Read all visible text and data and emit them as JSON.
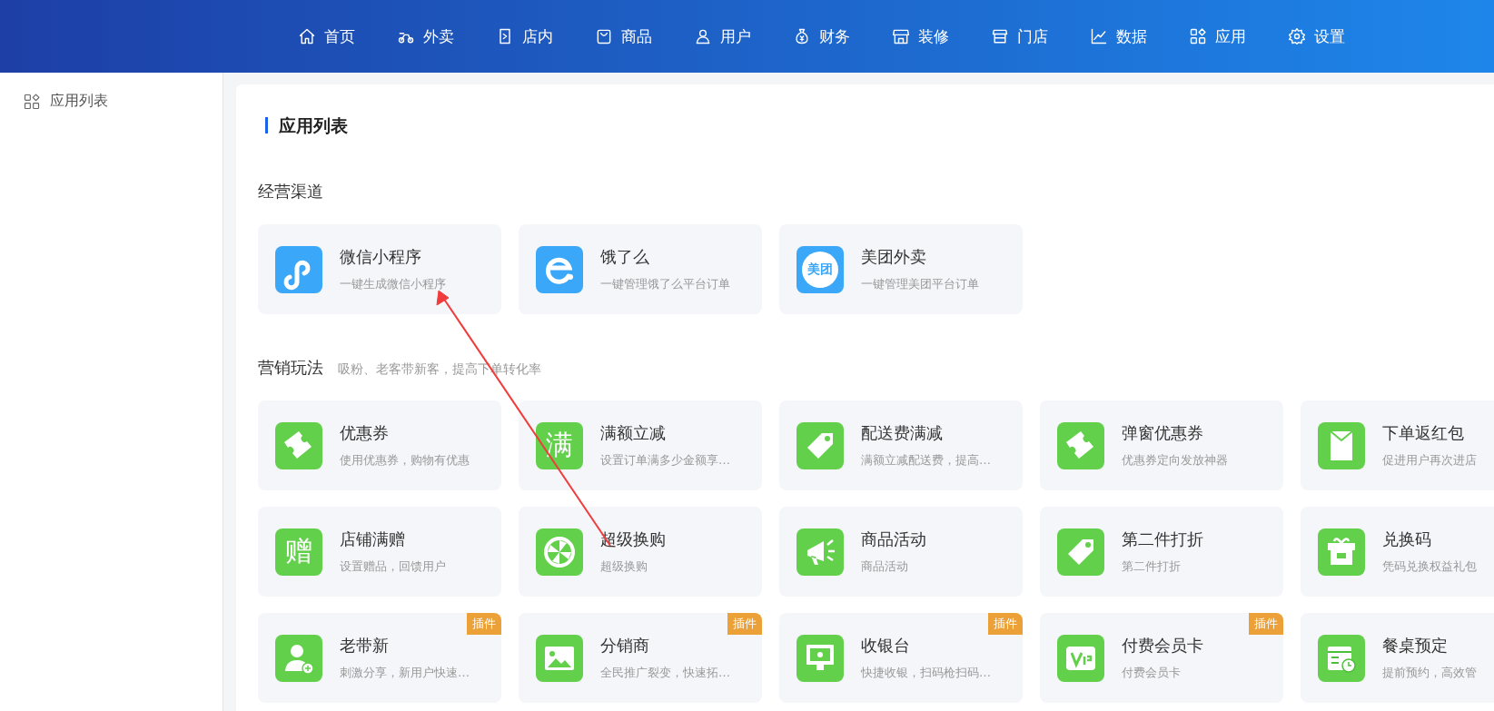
{
  "nav": [
    {
      "label": "首页"
    },
    {
      "label": "外卖"
    },
    {
      "label": "店内"
    },
    {
      "label": "商品"
    },
    {
      "label": "用户"
    },
    {
      "label": "财务"
    },
    {
      "label": "装修"
    },
    {
      "label": "门店"
    },
    {
      "label": "数据"
    },
    {
      "label": "应用"
    },
    {
      "label": "设置"
    }
  ],
  "sidebar": {
    "items": [
      {
        "label": "应用列表"
      }
    ]
  },
  "panel": {
    "title": "应用列表",
    "sections": [
      {
        "title": "经营渠道",
        "items": [
          {
            "title": "微信小程序",
            "description": "一键生成微信小程序"
          },
          {
            "title": "饿了么",
            "description": "一键管理饿了么平台订单"
          },
          {
            "title": "美团外卖",
            "description": "一键管理美团平台订单",
            "icon_text": "美团"
          }
        ]
      },
      {
        "title": "营销玩法",
        "subtitle": "吸粉、老客带新客，提高下单转化率",
        "items": [
          {
            "title": "优惠券",
            "description": "使用优惠券，购物有优惠"
          },
          {
            "title": "满额立减",
            "description": "设置订单满多少金额享…",
            "icon_text": "满"
          },
          {
            "title": "配送费满减",
            "description": "满额立减配送费，提高…"
          },
          {
            "title": "弹窗优惠券",
            "description": "优惠券定向发放神器"
          },
          {
            "title": "下单返红包",
            "description": "促进用户再次进店"
          },
          {
            "title": "店铺满赠",
            "description": "设置赠品，回馈用户",
            "icon_text": "赠"
          },
          {
            "title": "超级换购",
            "description": "超级换购"
          },
          {
            "title": "商品活动",
            "description": "商品活动"
          },
          {
            "title": "第二件打折",
            "description": "第二件打折"
          },
          {
            "title": "兑换码",
            "description": "凭码兑换权益礼包"
          },
          {
            "title": "老带新",
            "description": "刺激分享，新用户快速…",
            "badge": "插件"
          },
          {
            "title": "分销商",
            "description": "全民推广裂变，快速拓…",
            "badge": "插件"
          },
          {
            "title": "收银台",
            "description": "快捷收银，扫码枪扫码…",
            "badge": "插件"
          },
          {
            "title": "付费会员卡",
            "description": "付费会员卡",
            "badge": "插件"
          },
          {
            "title": "餐桌预定",
            "description": "提前预约，高效管"
          }
        ]
      }
    ]
  }
}
